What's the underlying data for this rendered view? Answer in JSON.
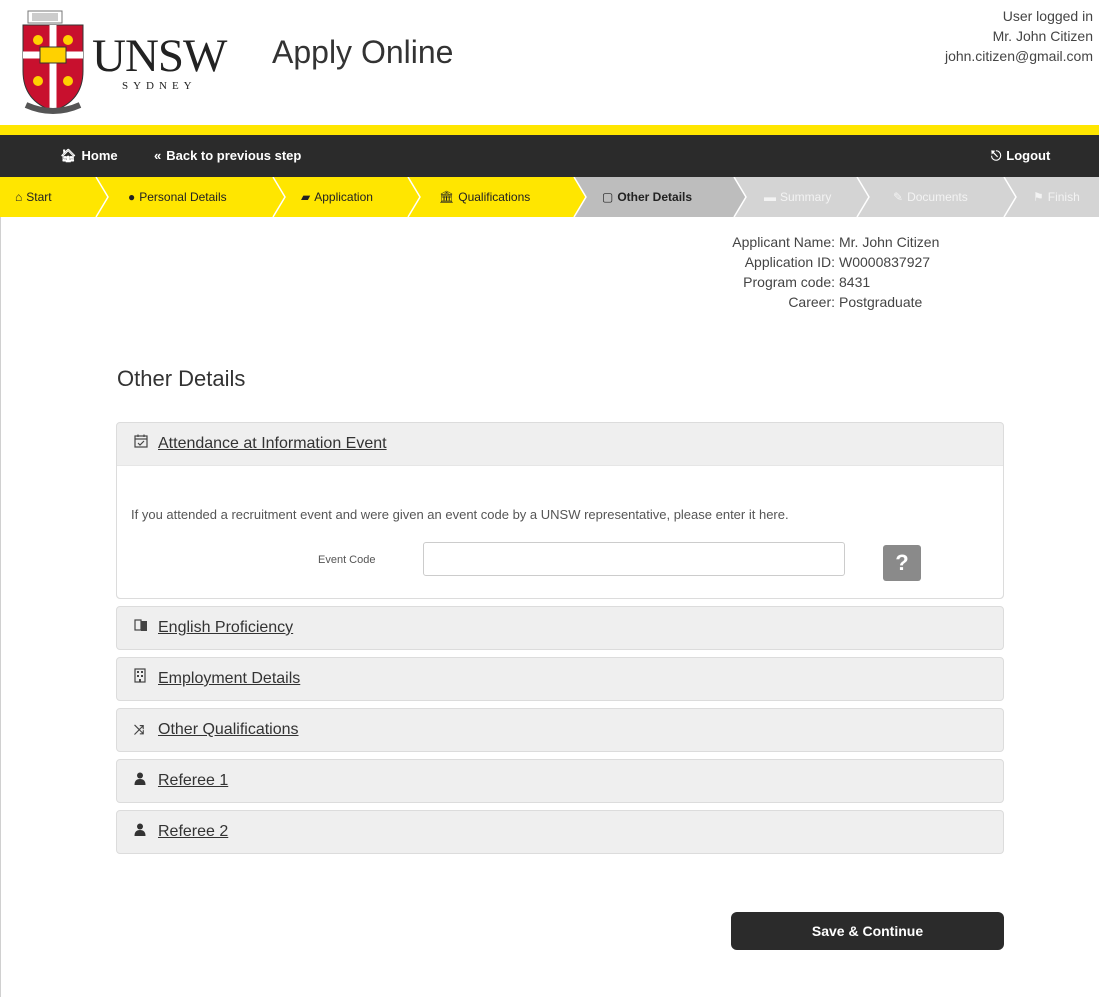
{
  "header": {
    "logo_main": "UNSW",
    "logo_sub": "SYDNEY",
    "app_title": "Apply Online",
    "user_status": "User logged in",
    "user_name": "Mr. John Citizen",
    "user_email": "john.citizen@gmail.com"
  },
  "topnav": {
    "home": "Home",
    "back": "Back to previous step",
    "logout": "Logout"
  },
  "steps": [
    {
      "label": "Start",
      "icon": "home-icon",
      "state": "done"
    },
    {
      "label": "Personal Details",
      "icon": "user-icon",
      "state": "done"
    },
    {
      "label": "Application",
      "icon": "book-icon",
      "state": "done"
    },
    {
      "label": "Qualifications",
      "icon": "bank-icon",
      "state": "done"
    },
    {
      "label": "Other Details",
      "icon": "file-icon",
      "state": "active"
    },
    {
      "label": "Summary",
      "icon": "list-icon",
      "state": "future"
    },
    {
      "label": "Documents",
      "icon": "paperclip-icon",
      "state": "future"
    },
    {
      "label": "Finish",
      "icon": "flag-icon",
      "state": "future"
    }
  ],
  "applicant": {
    "name_label": "Applicant Name:",
    "name": "Mr. John Citizen",
    "id_label": "Application ID:",
    "id": "W0000837927",
    "program_label": "Program code:",
    "program": "8431",
    "career_label": "Career:",
    "career": "Postgraduate"
  },
  "page_heading": "Other Details",
  "panels": [
    {
      "title": "Attendance at Information Event",
      "icon": "calendar-check-icon",
      "expanded": true
    },
    {
      "title": "English Proficiency",
      "icon": "language-icon"
    },
    {
      "title": "Employment Details",
      "icon": "building-icon"
    },
    {
      "title": "Other Qualifications",
      "icon": "random-icon"
    },
    {
      "title": "Referee 1",
      "icon": "user-icon"
    },
    {
      "title": "Referee 2",
      "icon": "user-icon"
    }
  ],
  "event": {
    "description": "If you attended a recruitment event and were given an event code by a UNSW representative, please enter it here.",
    "field_label": "Event Code",
    "field_value": "",
    "help": "?"
  },
  "save_button": "Save & Continue",
  "colors": {
    "brand_yellow": "#ffe600",
    "dark": "#2b2b2b",
    "panel_bg": "#efefef"
  }
}
